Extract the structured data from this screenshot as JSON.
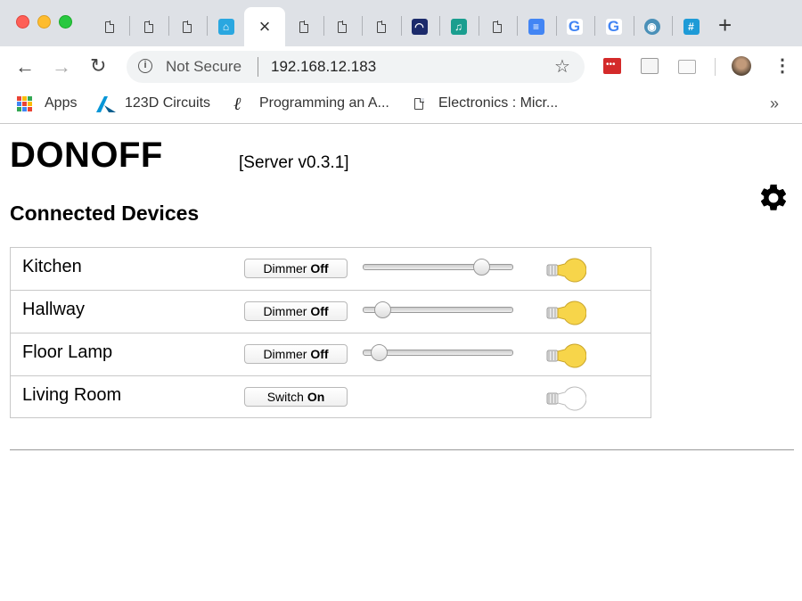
{
  "browser": {
    "tabs": [
      {
        "icon": "document-icon"
      },
      {
        "icon": "document-icon"
      },
      {
        "icon": "document-icon"
      },
      {
        "icon": "home-icon"
      },
      {
        "icon": "close-icon",
        "active": true
      },
      {
        "icon": "document-icon"
      },
      {
        "icon": "document-icon"
      },
      {
        "icon": "document-icon"
      },
      {
        "icon": "signal-icon"
      },
      {
        "icon": "music-icon"
      },
      {
        "icon": "document-icon"
      },
      {
        "icon": "docs-icon"
      },
      {
        "icon": "google-icon",
        "label": "G"
      },
      {
        "icon": "google-icon",
        "label": "G"
      },
      {
        "icon": "globe-icon"
      },
      {
        "icon": "hash-icon"
      }
    ],
    "security_label": "Not Secure",
    "url": "192.168.12.183",
    "bookmarks": [
      {
        "label": "Apps",
        "icon": "apps-icon"
      },
      {
        "label": "123D Circuits",
        "icon": "autodesk-icon"
      },
      {
        "label": "Programming an A...",
        "icon": "script-icon"
      },
      {
        "label": "Electronics : Micr...",
        "icon": "document-icon"
      }
    ],
    "overflow": "»"
  },
  "page": {
    "title": "DONOFF",
    "server_version": "[Server v0.3.1]",
    "section_title": "Connected Devices",
    "devices": [
      {
        "name": "Kitchen",
        "button_type": "Dimmer",
        "button_state": "Off",
        "has_slider": true,
        "level": 0.82,
        "bulb_on": true
      },
      {
        "name": "Hallway",
        "button_type": "Dimmer",
        "button_state": "Off",
        "has_slider": true,
        "level": 0.08,
        "bulb_on": true
      },
      {
        "name": "Floor Lamp",
        "button_type": "Dimmer",
        "button_state": "Off",
        "has_slider": true,
        "level": 0.05,
        "bulb_on": true
      },
      {
        "name": "Living Room",
        "button_type": "Switch",
        "button_state": "On",
        "has_slider": false,
        "bulb_on": false
      }
    ]
  },
  "colors": {
    "bulb_on": "#f7d54a",
    "bulb_off": "#ffffff",
    "tab_strip": "#dee1e6"
  }
}
